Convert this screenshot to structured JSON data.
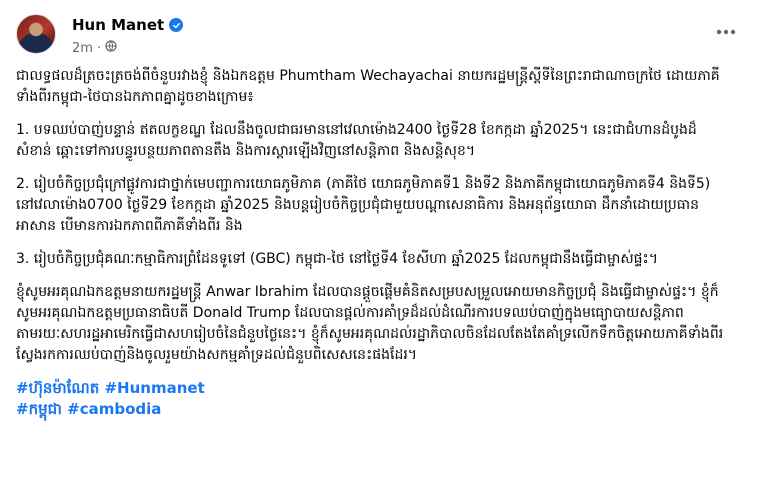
{
  "post": {
    "author": "Hun Manet",
    "time": "2m",
    "dot": "·",
    "paragraphs": [
      "ជាលទ្ធផលដ៏ត្រចះត្រចង់ពីចំនួបរវាងខ្ញុំ និងឯកឧត្តម Phumtham Wechayachai នាយករដ្ឋមន្ត្រីស្តីទីនៃព្រះរាជាណាចក្រថៃ ដោយភាគីទាំងពីរកម្ពុជា-ថៃបានឯកភាពគ្នាដូចខាងក្រោម៖",
      "1. បទឈប់បាញ់បន្ទាន់ ឥតលក្ខខណ្ឌ ដែលនឹងចូលជាធរមាននៅវេលាម៉ោង2400 ថ្ងៃទី28 ខែកក្កដា ឆ្នាំ2025។  នេះជាជំហានដំបូងដ៏សំខាន់ ឆ្ពោះទៅការបន្ធូរបន្ថយភាពតានតឹង និងការស្តារឡើងវិញនៅសន្តិភាព និងសន្តិសុខ។",
      "2. រៀបចំកិច្ចប្រជុំក្រៅផ្លូវការជាថ្នាក់មេបញ្ជាការយោធភូមិភាគ (ភាគីថៃ យោធភូមិភាគទី1 និងទី2 និងភាគីកម្ពុជាយោធភូមិភាគទី4 និងទី5) នៅវេលាម៉ោង0700 ថ្ងៃទី29 ខែកក្កដា ឆ្នាំ2025 និងបន្តរៀបចំកិច្ចប្រជុំជាមួយបណ្តាសេនាធិការ និងអនុព័ន្ធយោធា ដឹកនាំដោយប្រធានអាសាន បើមានការឯកភាពពីភាគីទាំងពីរ និង",
      "3. រៀបចំកិច្ចប្រជុំគណៈកម្មាធិការព្រំដែនទូទៅ (GBC) កម្ពុជា-ថៃ នៅថ្ងៃទី4 ខែសីហា ឆ្នាំ2025 ដែលកម្ពុជានឹងធ្វើជាម្ចាស់ផ្ទះ។",
      "ខ្ញុំសូមអរគុណឯកឧត្តមនាយករដ្ឋមន្ត្រី Anwar Ibrahim ដែលបានផ្តួចផ្តើមគំនិតសម្របសម្រួលអោយមានកិច្ចប្រជុំ និងធ្វើជាម្ចាស់ផ្ទះ។ ខ្ញុំក៏សូមអរគុណឯកឧត្តមប្រធានាធិបតី Donald Trump ដែលបានផ្តល់ការគាំទ្រដ៏ដល់ដំណើរការបទឈប់បាញ់ក្នុងមធ្យោបាយសន្តិភាព តាមរយៈសហរដ្ឋអាមេរិកធ្វើជាសហរៀបចំនៃជំនួបថ្ងៃនេះ។ ខ្ញុំក៏សូមអរគុណដល់រដ្ឋាភិបាលចិនដែលតែងតែគាំទ្រលើកទឹកចិត្តអោយភាគីទាំងពីរស្វែងរកការឈប់បាញ់និងចូលរួមយ៉ាងសកម្មគាំទ្រដល់ជំនួបពិសេសនេះផងដែរ។"
    ],
    "hashtags": [
      [
        "#ហ៊ុនម៉ាណែត",
        "#Hunmanet"
      ],
      [
        "#កម្ពុជា",
        "#cambodia"
      ]
    ]
  },
  "colors": {
    "link": "#1877f2",
    "verified": "#1877f2",
    "meta": "#65676b"
  },
  "icons": [
    "verified-badge-icon",
    "globe-icon",
    "more-options-icon"
  ]
}
